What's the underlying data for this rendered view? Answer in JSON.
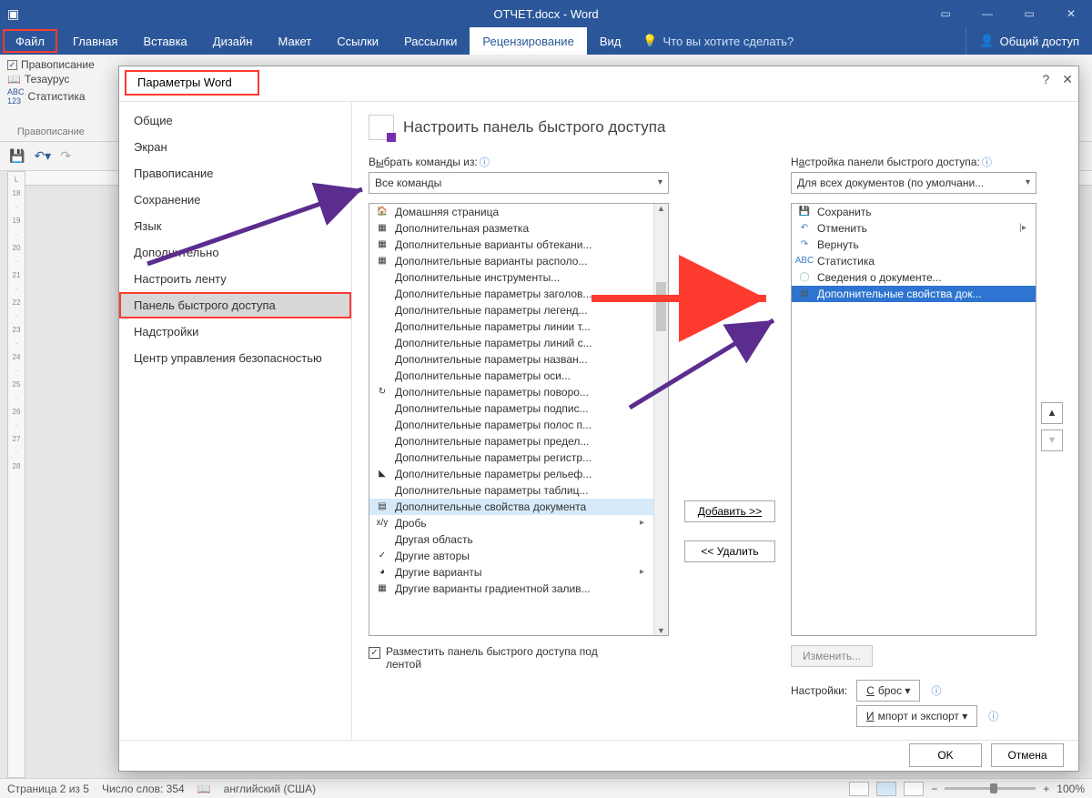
{
  "titlebar": {
    "title": "ОТЧЕТ.docx - Word"
  },
  "window_buttons": {
    "min": "—",
    "max": "▭",
    "close": "✕"
  },
  "ribbon_tabs": [
    "Файл",
    "Главная",
    "Вставка",
    "Дизайн",
    "Макет",
    "Ссылки",
    "Рассылки",
    "Рецензирование",
    "Вид"
  ],
  "active_tab_index": 7,
  "tellme": "Что вы хотите сделать?",
  "share": "Общий доступ",
  "ribbon_group": {
    "items": [
      "Правописание",
      "Тезаурус",
      "Статистика"
    ],
    "name": "Правописание"
  },
  "ruler_marks": [
    "L",
    "",
    "18",
    "",
    "19",
    "",
    "20",
    "",
    "21",
    "",
    "22",
    "",
    "23",
    "",
    "24",
    "",
    "25",
    "",
    "26",
    "",
    "27",
    "",
    "28"
  ],
  "statusbar": {
    "page": "Страница 2 из 5",
    "words": "Число слов: 354",
    "lang": "английский (США)",
    "zoom": "100%"
  },
  "dialog": {
    "title": "Параметры Word",
    "help": "?",
    "close": "✕",
    "nav": [
      "Общие",
      "Экран",
      "Правописание",
      "Сохранение",
      "Язык",
      "Дополнительно",
      "Настроить ленту",
      "Панель быстрого доступа",
      "Надстройки",
      "Центр управления безопасностью"
    ],
    "nav_sel_index": 7,
    "heading": "Настроить панель быстрого доступа",
    "left": {
      "label_pre": "В",
      "label_ul": "ы",
      "label_post": "брать команды из:",
      "dropdown": "Все команды",
      "items": [
        {
          "icon": "🏠",
          "text": "Домашняя страница"
        },
        {
          "icon": "▦",
          "text": "Дополнительная разметка"
        },
        {
          "icon": "▦",
          "text": "Дополнительные варианты обтекани..."
        },
        {
          "icon": "▦",
          "text": "Дополнительные варианты располо..."
        },
        {
          "icon": "",
          "text": "Дополнительные инструменты...",
          "sub": ""
        },
        {
          "icon": "",
          "text": "Дополнительные параметры заголов..."
        },
        {
          "icon": "",
          "text": "Дополнительные параметры легенд..."
        },
        {
          "icon": "",
          "text": "Дополнительные параметры линии т..."
        },
        {
          "icon": "",
          "text": "Дополнительные параметры линий с..."
        },
        {
          "icon": "",
          "text": "Дополнительные параметры назван..."
        },
        {
          "icon": "",
          "text": "Дополнительные параметры оси..."
        },
        {
          "icon": "↻",
          "text": "Дополнительные параметры поворо..."
        },
        {
          "icon": "",
          "text": "Дополнительные параметры подпис..."
        },
        {
          "icon": "",
          "text": "Дополнительные параметры полос п..."
        },
        {
          "icon": "",
          "text": "Дополнительные параметры предел..."
        },
        {
          "icon": "",
          "text": "Дополнительные параметры регистр..."
        },
        {
          "icon": "◣",
          "text": "Дополнительные параметры рельеф..."
        },
        {
          "icon": "",
          "text": "Дополнительные параметры таблиц..."
        },
        {
          "icon": "▤",
          "text": "Дополнительные свойства документа",
          "sel": true
        },
        {
          "icon": "x/y",
          "text": "Дробь",
          "sub": "▸"
        },
        {
          "icon": "",
          "text": "Другая область"
        },
        {
          "icon": "✓",
          "text": "Другие авторы"
        },
        {
          "icon": "◕",
          "text": "Другие варианты",
          "sub": "▸"
        },
        {
          "icon": "▦",
          "text": "Другие варианты градиентной залив...",
          "sub": ""
        }
      ]
    },
    "mid": {
      "add": "Добавить >>",
      "remove": "<< Удалить"
    },
    "right": {
      "label_pre": "Н",
      "label_ul": "а",
      "label_post": "стройка панели быстрого доступа:",
      "dropdown": "Для всех документов (по умолчани...",
      "items": [
        {
          "icon": "💾",
          "text": "Сохранить",
          "color": "#4a7fc1"
        },
        {
          "icon": "↶",
          "text": "Отменить",
          "color": "#3b78cc",
          "sub": "|▸"
        },
        {
          "icon": "↷",
          "text": "Вернуть",
          "color": "#3b78cc"
        },
        {
          "icon": "ABC",
          "text": "Статистика",
          "color": "#3b78cc"
        },
        {
          "icon": "◯",
          "text": "Сведения о документе...",
          "color": "#8fc9a8"
        },
        {
          "icon": "▤",
          "text": "Дополнительные свойства док...",
          "selblue": true
        }
      ],
      "up": "▲",
      "down": "▼",
      "modify": "Изменить...",
      "settings_label": "Настройки:",
      "reset": "Сброс ▾",
      "import": "Импорт и экспорт ▾"
    },
    "below_checkbox": "Разместить панель быстрого доступа под лентой",
    "ok": "OK",
    "cancel": "Отмена"
  }
}
